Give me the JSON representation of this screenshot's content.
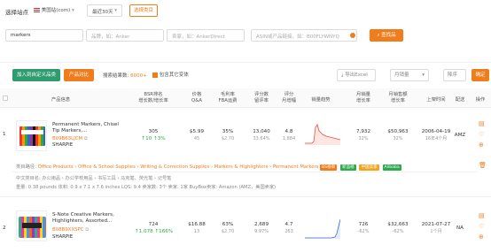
{
  "filters": {
    "site_label": "选择站点",
    "site_value": "美国站(com)",
    "date_value": "最近30天",
    "select_category": "选择类目",
    "keyword": "markers",
    "brand_placeholder": "品牌，如：Anker",
    "seller_placeholder": "卖家，如：AnkerDirect",
    "asin_placeholder": "ASIN或产品链接，如：B00FLYWNYQ",
    "search_button": "查找品"
  },
  "toolbar": {
    "add_button": "加入到自定义品类",
    "compare_button": "产品对比",
    "result_prefix": "搜索结果数:",
    "result_count": "6000+",
    "include_variants": "包含其它变体",
    "export_button": "导出Excel",
    "period_select": "月销量",
    "order_select": "降序",
    "search_small_button": "确定"
  },
  "columns": {
    "product_info": "产品信息",
    "bsr": "BSR排名\n增长数/增长率",
    "price": "价格\nQ&A",
    "gross": "毛利率\nFBA运费",
    "reviews": "评分数\n留评率",
    "rating": "评分\n月增幅",
    "trend": "销量趋势",
    "monthly_sales": "月销量\n增长率",
    "monthly_revenue": "月销售额\n增长率",
    "launch": "上架时间",
    "fulfillment": "配送",
    "action": "操作"
  },
  "rows": [
    {
      "index": "1",
      "title": "Permanent Markers, Chisel Tip Markers,...",
      "asin": "B09B63LJCM",
      "brand": "SHARPIE",
      "bsr": "305",
      "bsr_change": "↑10 ↑3%",
      "price": "$5.99",
      "qa": "45",
      "gross": "35%",
      "fba": "$2.70",
      "reviews": "13,040",
      "review_rate": "33.64%",
      "rating": "4.8",
      "rating_inc": "1,884",
      "monthly_sales": "7,932",
      "sales_growth": "32%",
      "revenue": "$50,963",
      "revenue_growth": "32%",
      "launch_date": "2006-04-19",
      "launch_age": "16年4个月",
      "fulfillment": "AMZ",
      "category_label": "类目路径:",
      "category_path": "Office Products › Office & School Supplies › Writing & Correction Supplies › Markers & Highlighters › Permanent Markers",
      "tags": [
        "BS榜单",
        "新品榜",
        "中国卖家",
        "Alibaba"
      ],
      "detail_line1": "中文类目名: 办公用品 › 办公学校用品 › 书写工具 › 马克笔、荧光笔 › 记号笔",
      "detail_line2": "重量: 0.38 pounds   体积: 0.9 x 7.1 x 7.6 inches   LQS: 9.4   卖家数: 3个   卖家: 1家   BuyBox卖家: Amazon (AMZ，美国卖家)"
    },
    {
      "index": "2",
      "title": "S-Note Creative Markers, Highlighters, Assorted...",
      "asin": "B08B9XXSPC",
      "brand": "SHARPIE",
      "bsr": "724",
      "bsr_change": "↑1,078 ↑166%",
      "price": "$16.88",
      "qa": "13",
      "gross": "63%",
      "fba": "$2.70",
      "reviews": "2,689",
      "review_rate": "9.97%",
      "rating": "4.7",
      "rating_inc": "263",
      "monthly_sales": "726",
      "sales_growth": "-62%",
      "revenue": "$32,663",
      "revenue_growth": "-62%",
      "launch_date": "2021-07-27",
      "launch_age": "1个月",
      "fulfillment": "NA"
    }
  ],
  "colors": {
    "accent": "#f07d1c",
    "green": "#2fa84f",
    "red": "#e1523d"
  }
}
